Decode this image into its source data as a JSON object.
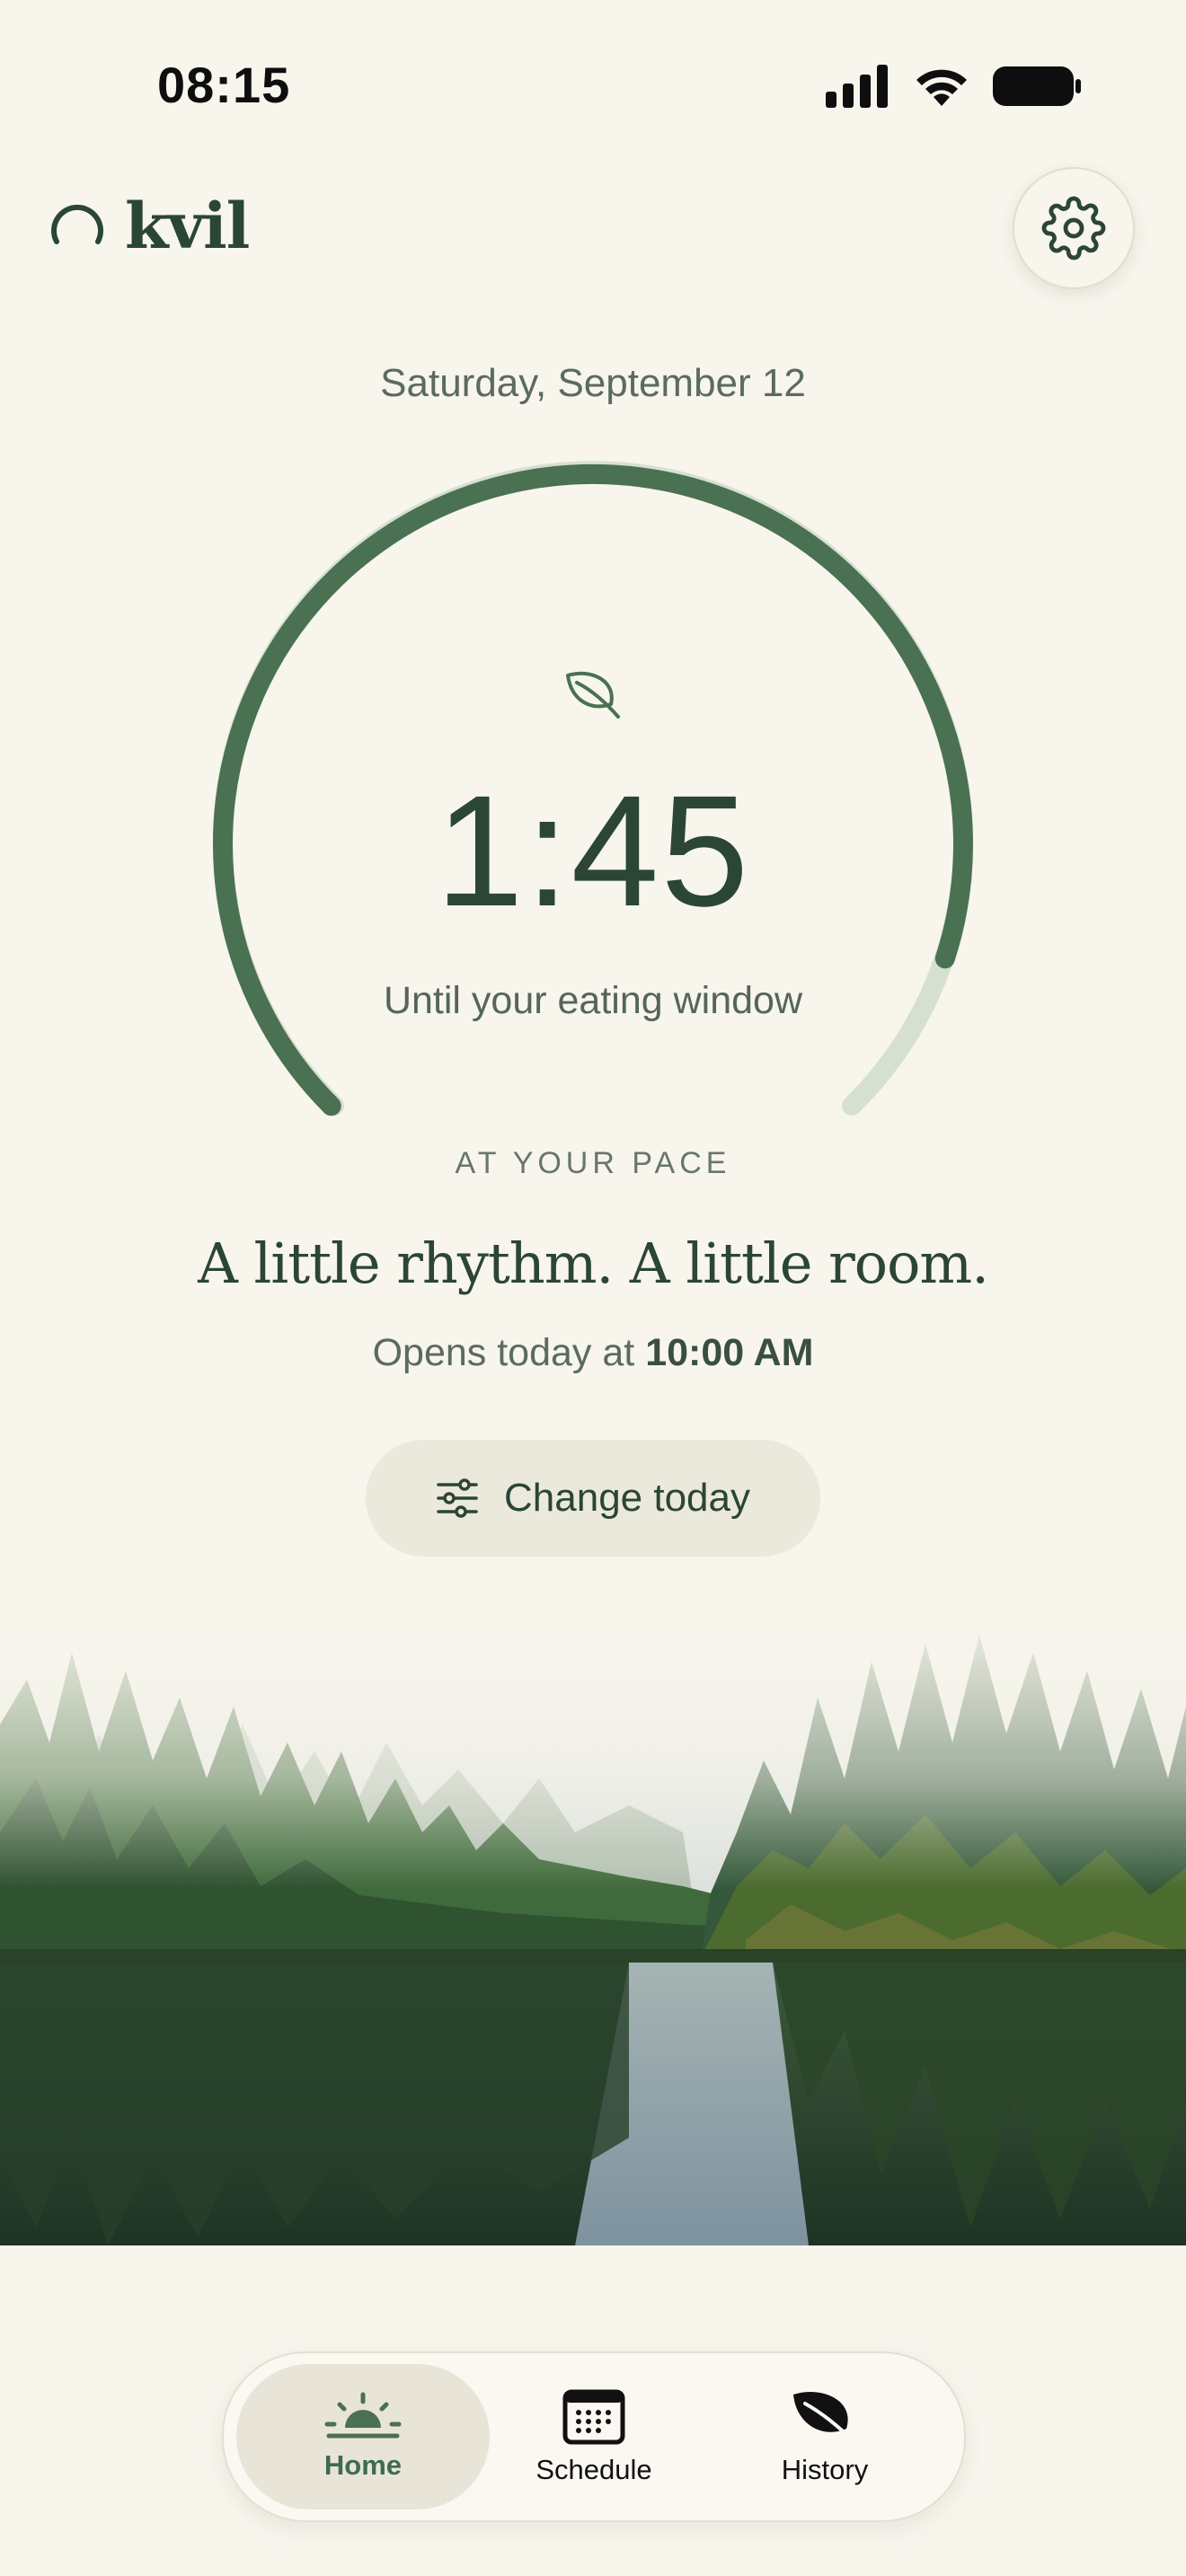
{
  "status_bar": {
    "time": "08:15"
  },
  "header": {
    "app_name": "kvil",
    "settings_icon": "gear-icon"
  },
  "main": {
    "date": "Saturday, September 12",
    "countdown": "1:45",
    "countdown_caption": "Until your eating window",
    "progress_fraction": 0.9,
    "pace_label": "AT YOUR PACE",
    "headline": "A little rhythm. A little room.",
    "opens_prefix": "Opens today at",
    "opens_time": "10:00 AM",
    "change_button_label": "Change today",
    "change_button_icon": "sliders-icon"
  },
  "nav": {
    "items": [
      {
        "label": "Home",
        "icon": "sunrise-icon",
        "active": true
      },
      {
        "label": "Schedule",
        "icon": "calendar-icon",
        "active": false
      },
      {
        "label": "History",
        "icon": "leaf-icon",
        "active": false
      }
    ]
  },
  "colors": {
    "background": "#f7f5ec",
    "accent": "#4a7152",
    "accent_light": "#d6e0d0",
    "text_dark": "#2b4536"
  }
}
